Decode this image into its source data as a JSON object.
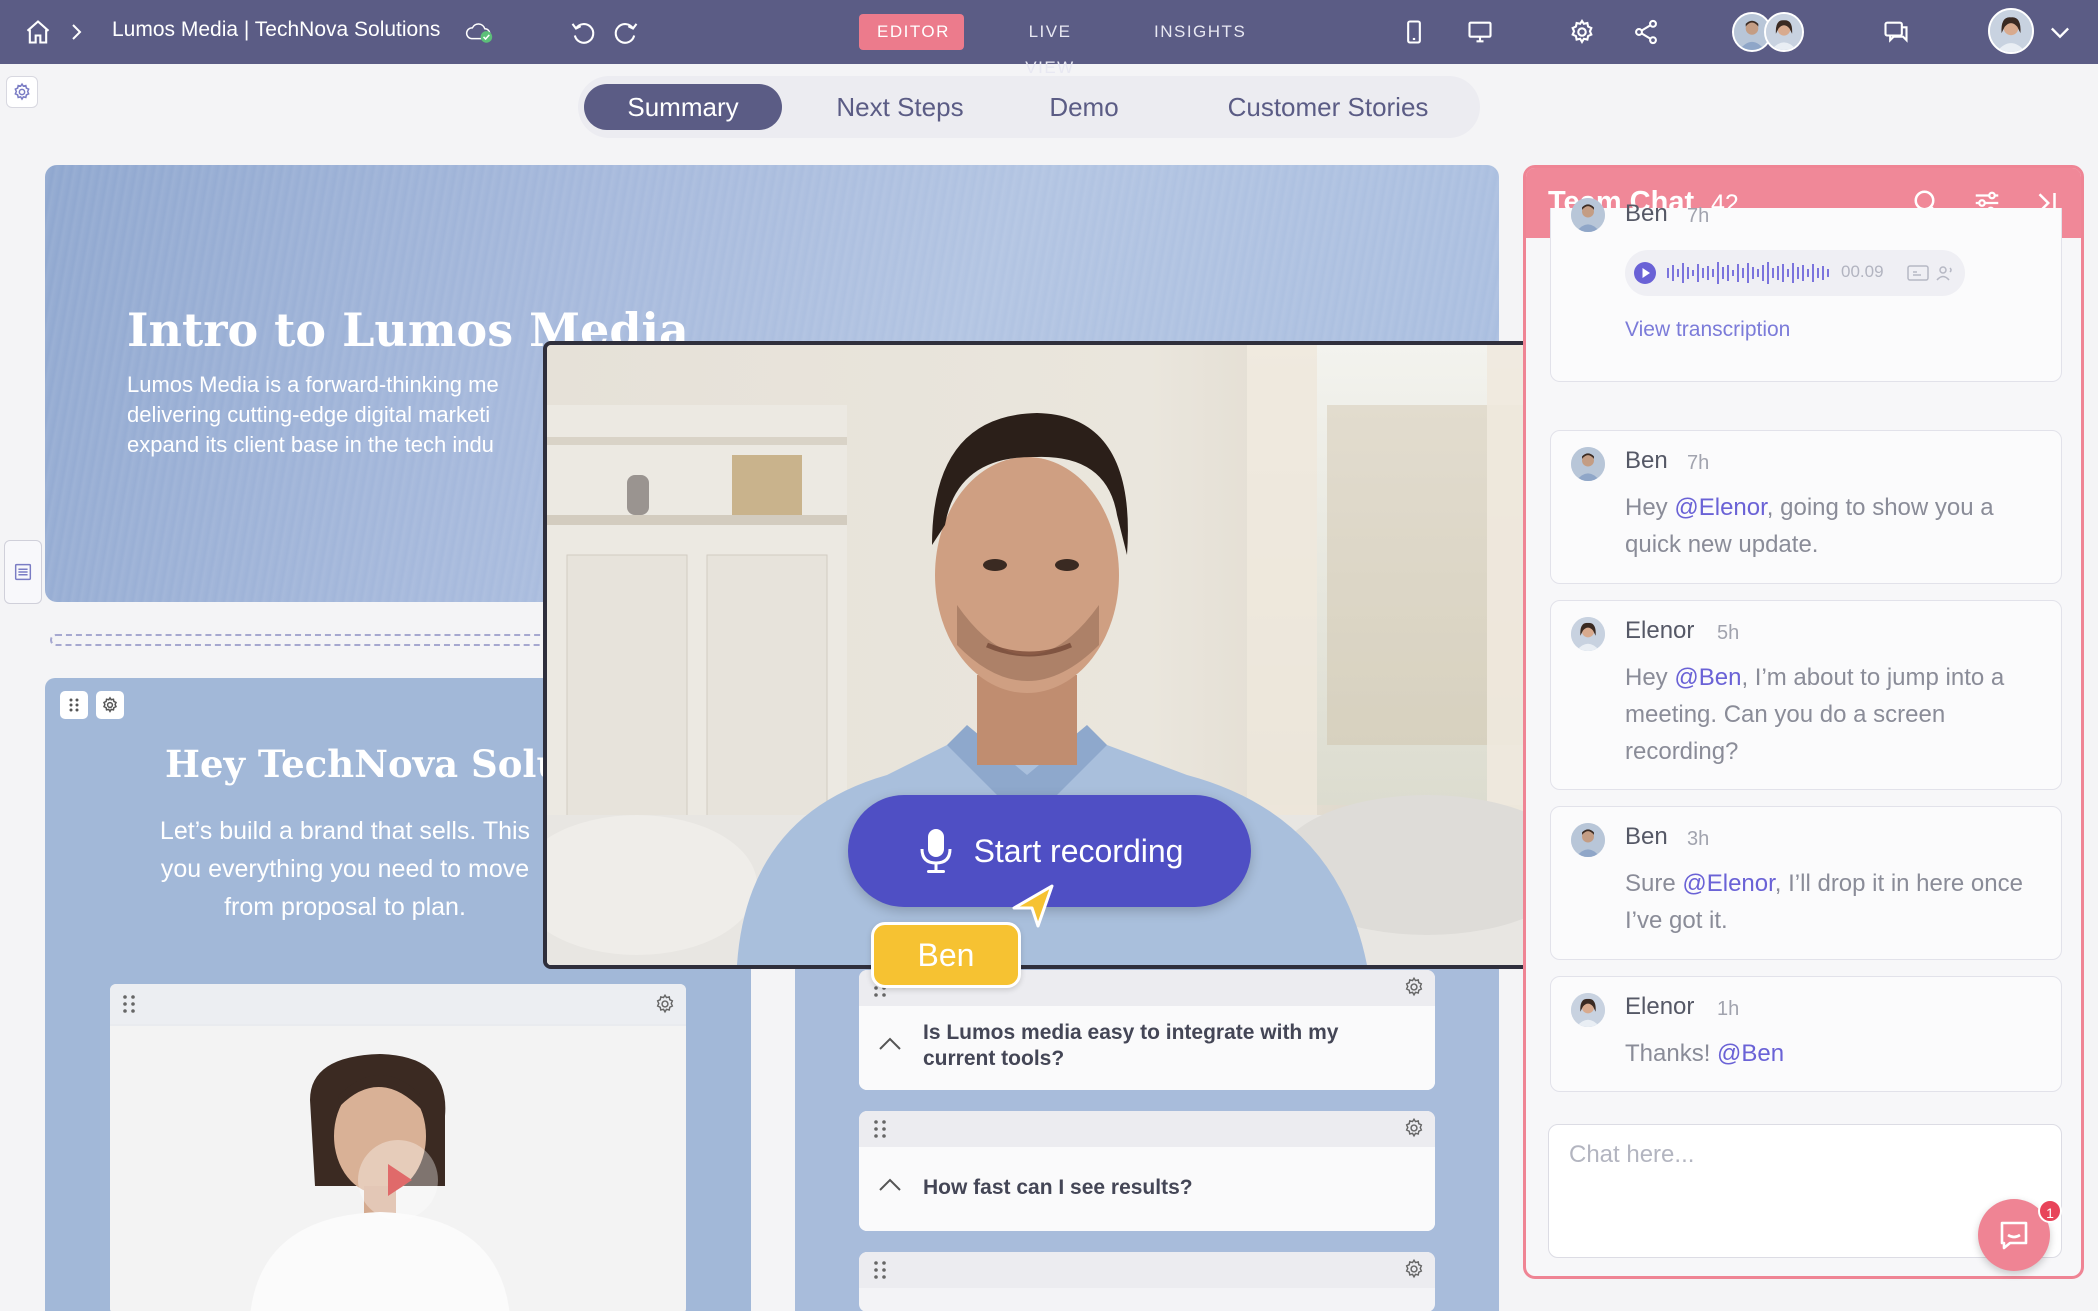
{
  "topbar": {
    "breadcrumb": "Lumos Media | TechNova Solutions",
    "modes": [
      "EDITOR",
      "LIVE VIEW",
      "INSIGHTS"
    ],
    "active_mode": "EDITOR"
  },
  "section_tabs": [
    "Summary",
    "Next Steps",
    "Demo",
    "Customer Stories"
  ],
  "active_section": "Summary",
  "hero": {
    "title": "Intro to Lumos Media",
    "description": "Lumos Media is a forward-thinking me\ndelivering cutting-edge digital marketi\nexpand its client base in the tech indu"
  },
  "welcome": {
    "title": "Hey TechNova Solut",
    "description": "Let’s build a brand that sells. This\nyou everything you need to move\nfrom proposal to plan."
  },
  "faq": [
    {
      "question": "Is Lumos media easy to integrate with my current tools?"
    },
    {
      "question": "How fast can I see results?"
    }
  ],
  "recording": {
    "button_label": "Start recording",
    "presenter_tag": "Ben"
  },
  "chat": {
    "title": "Team Chat",
    "count": "42",
    "messages": [
      {
        "author": "Ben",
        "time": "7h",
        "type": "audio",
        "duration": "00.09",
        "link": "View transcription"
      },
      {
        "author": "Ben",
        "time": "7h",
        "pre": "Hey ",
        "mention": "@Elenor",
        "post": ", going to show you a quick new update."
      },
      {
        "author": "Elenor",
        "time": "5h",
        "pre": "Hey ",
        "mention": "@Ben",
        "post": ", I’m about to jump into a meeting. Can you do a screen recording?"
      },
      {
        "author": "Ben",
        "time": "3h",
        "pre": "Sure ",
        "mention": "@Elenor",
        "post": ", I’ll drop it in here once I’ve got it."
      },
      {
        "author": "Elenor",
        "time": "1h",
        "pre": "Thanks! ",
        "mention": "@Ben",
        "post": ""
      }
    ],
    "input_placeholder": "Chat here...",
    "notification_count": "1"
  },
  "colors": {
    "topbar": "#5b5c85",
    "editor_badge": "#ec7b8c",
    "chat_accent": "#f08898",
    "record_button": "#4f4fc4",
    "presenter_tag": "#f6c232",
    "mention": "#6a62d6"
  },
  "icons": [
    "home-icon",
    "chevron-right-icon",
    "cloud-check-icon",
    "undo-icon",
    "redo-icon",
    "mobile-icon",
    "desktop-icon",
    "gear-icon",
    "share-icon",
    "comments-icon",
    "chevron-down-icon",
    "search-icon",
    "filter-icon",
    "collapse-panel-icon",
    "microphone-icon",
    "play-icon",
    "list-icon",
    "drag-handle-icon",
    "chat-bubble-icon"
  ]
}
